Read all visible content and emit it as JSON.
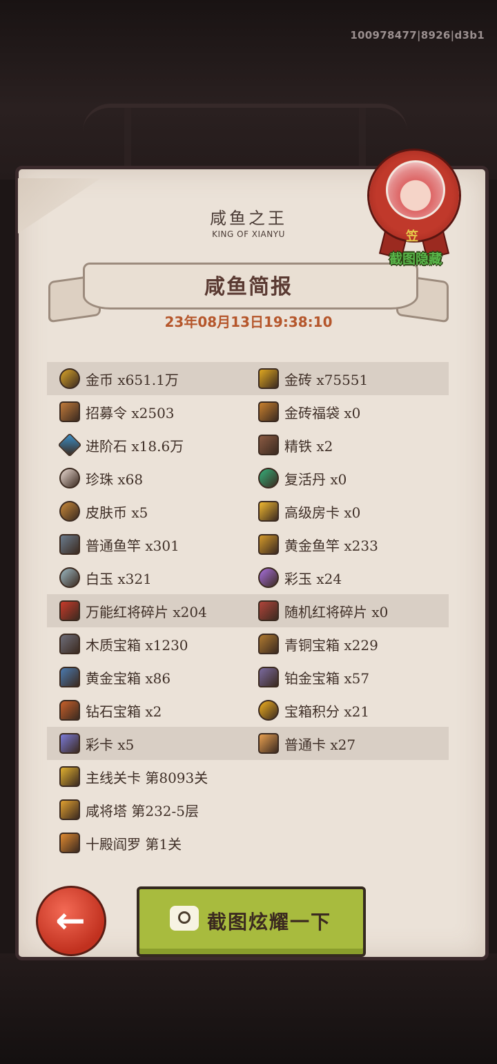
{
  "build_id": "100978477|8926|d3b1",
  "header": {
    "subtitle": "咸鱼之王",
    "subtitle_en": "KING OF XIANYU",
    "title": "咸鱼简报",
    "date": "23年08月13日19:38:10"
  },
  "seal": {
    "mark": "笠",
    "hide_label": "截图隐藏"
  },
  "rows": [
    {
      "highlight": true,
      "left": {
        "icon": "gold-coin-icon",
        "color": "#d9a52a",
        "label": "金币 x651.1万"
      },
      "right": {
        "icon": "gold-brick-icon",
        "color": "#e0a820",
        "label": "金砖 x75551"
      }
    },
    {
      "highlight": false,
      "left": {
        "icon": "recruit-token-icon",
        "color": "#c07a3a",
        "label": "招募令 x2503"
      },
      "right": {
        "icon": "gold-brick-bag-icon",
        "color": "#c8802e",
        "label": "金砖福袋 x0"
      }
    },
    {
      "highlight": false,
      "left": {
        "icon": "advance-stone-icon",
        "color": "#3a8fc8",
        "label": "进阶石 x18.6万"
      },
      "right": {
        "icon": "refined-iron-icon",
        "color": "#8a5a42",
        "label": "精铁 x2"
      }
    },
    {
      "highlight": false,
      "left": {
        "icon": "pearl-icon",
        "color": "#e8d8d0",
        "label": "珍珠 x68"
      },
      "right": {
        "icon": "revive-pill-icon",
        "color": "#35b07a",
        "label": "复活丹 x0"
      }
    },
    {
      "highlight": false,
      "left": {
        "icon": "skin-coin-icon",
        "color": "#c98a3a",
        "label": "皮肤币 x5"
      },
      "right": {
        "icon": "premium-room-card-icon",
        "color": "#f0b830",
        "label": "高级房卡 x0"
      }
    },
    {
      "highlight": false,
      "left": {
        "icon": "fishing-rod-icon",
        "color": "#6a7c8e",
        "label": "普通鱼竿 x301"
      },
      "right": {
        "icon": "golden-fishing-rod-icon",
        "color": "#d49a2a",
        "label": "黄金鱼竿 x233"
      }
    },
    {
      "highlight": false,
      "left": {
        "icon": "white-jade-icon",
        "color": "#9bb8c2",
        "label": "白玉 x321"
      },
      "right": {
        "icon": "color-jade-icon",
        "color": "#a870e0",
        "label": "彩玉 x24"
      }
    },
    {
      "highlight": true,
      "left": {
        "icon": "red-general-shard-icon",
        "color": "#c83a2a",
        "label": "万能红将碎片 x204"
      },
      "right": {
        "icon": "random-red-general-shard-icon",
        "color": "#b0443a",
        "label": "随机红将碎片 x0"
      }
    },
    {
      "highlight": false,
      "left": {
        "icon": "wooden-chest-icon",
        "color": "#6e6e7a",
        "label": "木质宝箱 x1230"
      },
      "right": {
        "icon": "bronze-chest-icon",
        "color": "#b07a30",
        "label": "青铜宝箱 x229"
      }
    },
    {
      "highlight": false,
      "left": {
        "icon": "gold-chest-icon",
        "color": "#4a7ab0",
        "label": "黄金宝箱 x86"
      },
      "right": {
        "icon": "platinum-chest-icon",
        "color": "#7a6aa0",
        "label": "铂金宝箱 x57"
      }
    },
    {
      "highlight": false,
      "left": {
        "icon": "diamond-chest-icon",
        "color": "#c8602a",
        "label": "钻石宝箱 x2"
      },
      "right": {
        "icon": "chest-points-icon",
        "color": "#f0b020",
        "label": "宝箱积分 x21"
      }
    },
    {
      "highlight": true,
      "left": {
        "icon": "color-card-icon",
        "color": "#7a7ad8",
        "label": "彩卡 x5"
      },
      "right": {
        "icon": "normal-card-icon",
        "color": "#e8a050",
        "label": "普通卡 x27"
      }
    },
    {
      "highlight": false,
      "left": {
        "icon": "main-stage-icon",
        "color": "#e0b030",
        "label": "主线关卡 第8093关"
      },
      "right": null
    },
    {
      "highlight": false,
      "left": {
        "icon": "tower-icon",
        "color": "#e0a030",
        "label": "咸将塔 第232-5层"
      },
      "right": null
    },
    {
      "highlight": false,
      "left": {
        "icon": "ten-halls-icon",
        "color": "#e08a30",
        "label": "十殿阎罗 第1关"
      },
      "right": null
    }
  ],
  "buttons": {
    "back": "←",
    "share": "截图炫耀一下"
  }
}
